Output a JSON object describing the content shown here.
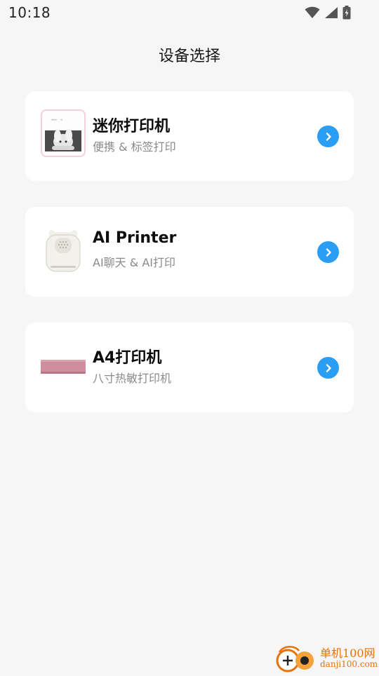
{
  "status_bar": {
    "time": "10:18",
    "icons": [
      "wifi-icon",
      "cell-signal-icon",
      "battery-charging-icon"
    ]
  },
  "page": {
    "title": "设备选择"
  },
  "devices": [
    {
      "title": "迷你打印机",
      "subtitle": "便携 & 标签打印",
      "image": "mini-printer-thumbnail"
    },
    {
      "title": "AI Printer",
      "subtitle": "AI聊天 & AI打印",
      "image": "ai-printer-thumbnail"
    },
    {
      "title": "A4打印机",
      "subtitle": "八寸热敏打印机",
      "image": "a4-printer-thumbnail"
    }
  ],
  "colors": {
    "accent": "#2a9df4",
    "background": "#f6f6f6",
    "card": "#ffffff",
    "subtitle": "#8a8a8a"
  },
  "watermark": {
    "line1": "单机100网",
    "line2": "danji100.com"
  }
}
